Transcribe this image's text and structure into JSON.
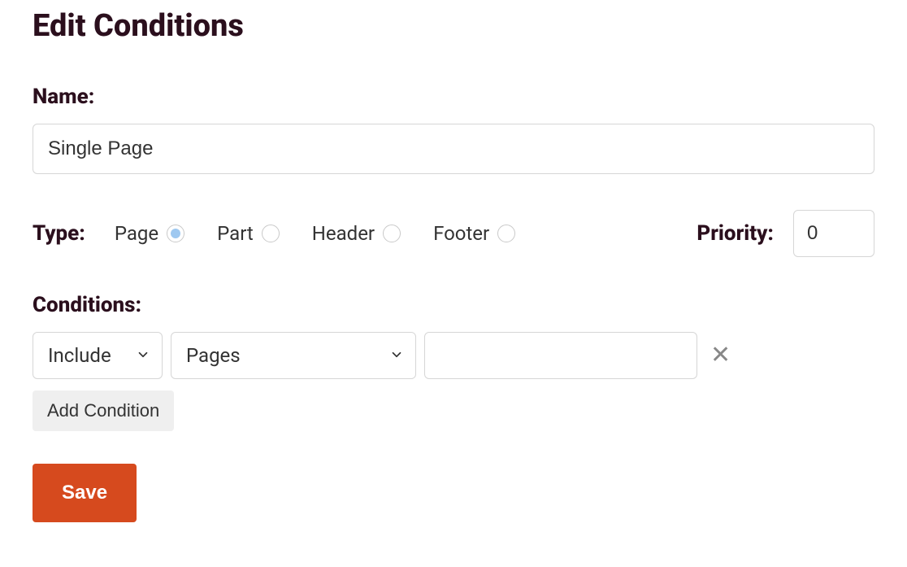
{
  "title": "Edit Conditions",
  "name": {
    "label": "Name:",
    "value": "Single Page"
  },
  "type": {
    "label": "Type:",
    "options": [
      {
        "label": "Page",
        "selected": true
      },
      {
        "label": "Part",
        "selected": false
      },
      {
        "label": "Header",
        "selected": false
      },
      {
        "label": "Footer",
        "selected": false
      }
    ]
  },
  "priority": {
    "label": "Priority:",
    "value": "0"
  },
  "conditions": {
    "label": "Conditions:",
    "rows": [
      {
        "mode": "Include",
        "target": "Pages",
        "value": ""
      }
    ],
    "add_label": "Add Condition"
  },
  "save_label": "Save"
}
